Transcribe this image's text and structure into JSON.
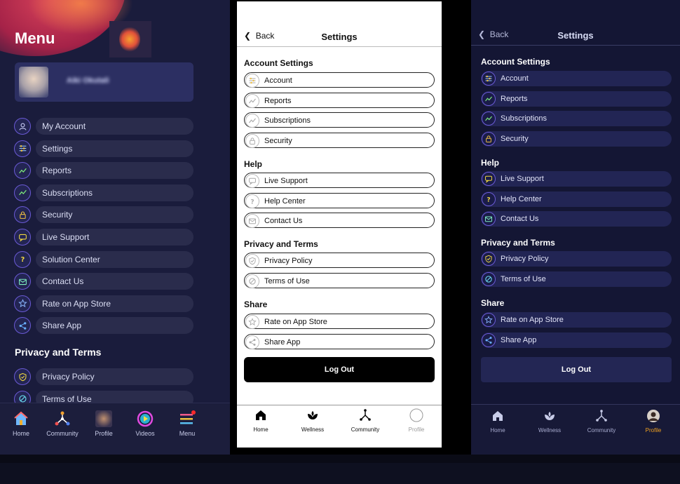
{
  "colors": {
    "accent_dark_bg": "#1a1c3c",
    "icon_ring": "#6b5ad6",
    "active_tab": "#f0a020"
  },
  "menu": {
    "title": "Menu",
    "user_name": "Aiki Okutali",
    "items": [
      {
        "label": "My Account",
        "icon": "user-icon"
      },
      {
        "label": "Settings",
        "icon": "sliders-icon"
      },
      {
        "label": "Reports",
        "icon": "trend-icon"
      },
      {
        "label": "Subscriptions",
        "icon": "trend-icon"
      },
      {
        "label": "Security",
        "icon": "lock-icon"
      },
      {
        "label": "Live Support",
        "icon": "chat-icon"
      },
      {
        "label": "Solution Center",
        "icon": "question-icon"
      },
      {
        "label": "Contact Us",
        "icon": "mail-icon"
      },
      {
        "label": "Rate on App Store",
        "icon": "star-icon"
      },
      {
        "label": "Share App",
        "icon": "share-icon"
      }
    ],
    "privacy_heading": "Privacy and Terms",
    "privacy_items": [
      {
        "label": "Privacy Policy",
        "icon": "shield-icon"
      },
      {
        "label": "Terms of Use",
        "icon": "block-icon"
      }
    ],
    "nav": [
      "Home",
      "Community",
      "Profile",
      "Videos",
      "Menu"
    ]
  },
  "settings": {
    "back": "Back",
    "title": "Settings",
    "groups": [
      {
        "heading": "Account Settings",
        "items": [
          "Account",
          "Reports",
          "Subscriptions",
          "Security"
        ]
      },
      {
        "heading": "Help",
        "items": [
          "Live Support",
          "Help Center",
          "Contact Us"
        ]
      },
      {
        "heading": "Privacy and Terms",
        "items": [
          "Privacy Policy",
          "Terms of Use"
        ]
      },
      {
        "heading": "Share",
        "items": [
          "Rate on App Store",
          "Share App"
        ]
      }
    ],
    "logout": "Log Out",
    "nav": [
      "Home",
      "Wellness",
      "Community",
      "Profile"
    ],
    "active_tab_light": "Home",
    "active_tab_dark": "Profile"
  }
}
